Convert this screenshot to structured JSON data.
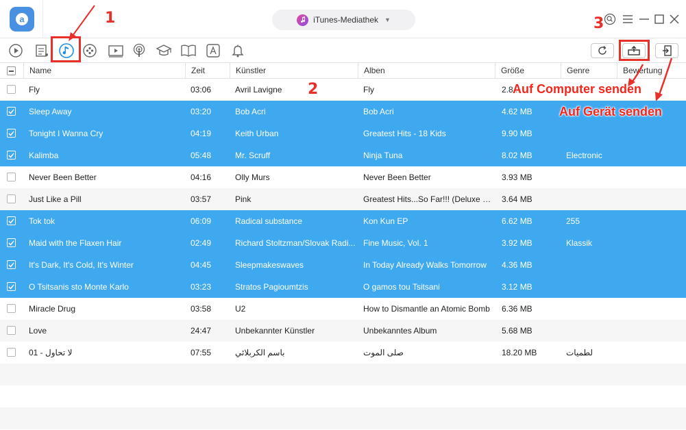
{
  "header": {
    "library_label": "iTunes-Mediathek"
  },
  "toolbar": {
    "categories": [
      "video-icon",
      "playlist-icon",
      "music-icon",
      "ringtone-icon",
      "movie-icon",
      "podcast-icon",
      "itunes-u-icon",
      "books-icon",
      "apps-icon",
      "notification-icon"
    ],
    "active": "music-icon",
    "actions": [
      "refresh-icon",
      "to-computer-icon",
      "to-device-icon"
    ]
  },
  "table": {
    "columns": [
      "Name",
      "Zeit",
      "Künstler",
      "Alben",
      "Größe",
      "Genre",
      "Bewertung"
    ],
    "rows": [
      {
        "name": "Fly",
        "time": "03:06",
        "artist": "Avril Lavigne",
        "album": "Fly",
        "size": "2.8...",
        "genre": "",
        "selected": false
      },
      {
        "name": "Sleep Away",
        "time": "03:20",
        "artist": "Bob Acri",
        "album": "Bob Acri",
        "size": "4.62 MB",
        "genre": "",
        "selected": true
      },
      {
        "name": "Tonight I Wanna Cry",
        "time": "04:19",
        "artist": "Keith Urban",
        "album": "Greatest Hits - 18 Kids",
        "size": "9.90 MB",
        "genre": "",
        "selected": true
      },
      {
        "name": "Kalimba",
        "time": "05:48",
        "artist": "Mr. Scruff",
        "album": "Ninja Tuna",
        "size": "8.02 MB",
        "genre": "Electronic",
        "selected": true
      },
      {
        "name": "Never Been Better",
        "time": "04:16",
        "artist": "Olly Murs",
        "album": "Never Been Better",
        "size": "3.93 MB",
        "genre": "",
        "selected": false
      },
      {
        "name": "Just Like a Pill",
        "time": "03:57",
        "artist": "Pink",
        "album": "Greatest Hits...So Far!!! (Deluxe V...",
        "size": "3.64 MB",
        "genre": "",
        "selected": false
      },
      {
        "name": "Tok tok",
        "time": "06:09",
        "artist": "Radical substance",
        "album": "Kon Kun EP",
        "size": "6.62 MB",
        "genre": "255",
        "selected": true
      },
      {
        "name": "Maid with the Flaxen Hair",
        "time": "02:49",
        "artist": "Richard Stoltzman/Slovak Radi...",
        "album": "Fine Music, Vol. 1",
        "size": "3.92 MB",
        "genre": "Klassik",
        "selected": true
      },
      {
        "name": "It's Dark, It's Cold, It's Winter",
        "time": "04:45",
        "artist": "Sleepmakeswaves",
        "album": "In Today Already Walks Tomorrow",
        "size": "4.36 MB",
        "genre": "",
        "selected": true
      },
      {
        "name": "O Tsitsanis sto Monte Karlo",
        "time": "03:23",
        "artist": "Stratos Pagioumtzis",
        "album": "O gamos tou Tsitsani",
        "size": "3.12 MB",
        "genre": "",
        "selected": true
      },
      {
        "name": "Miracle Drug",
        "time": "03:58",
        "artist": "U2",
        "album": "How to Dismantle an Atomic Bomb",
        "size": "6.36 MB",
        "genre": "",
        "selected": false
      },
      {
        "name": "Love",
        "time": "24:47",
        "artist": "Unbekannter Künstler",
        "album": "Unbekanntes Album",
        "size": "5.68 MB",
        "genre": "",
        "selected": false
      },
      {
        "name": "01 - لا تحاول",
        "time": "07:55",
        "artist": "باسم الكربلائي",
        "album": "صلى الموت",
        "size": "18.20 MB",
        "genre": "لطميات",
        "selected": false
      }
    ]
  },
  "annotations": {
    "step1": "1",
    "step2": "2",
    "step3": "3",
    "to_computer": "Auf Computer senden",
    "to_device": "Auf Gerät senden"
  },
  "colors": {
    "selection": "#3fa9f0",
    "annotation": "#e8302a",
    "accent": "#4a90e2"
  }
}
